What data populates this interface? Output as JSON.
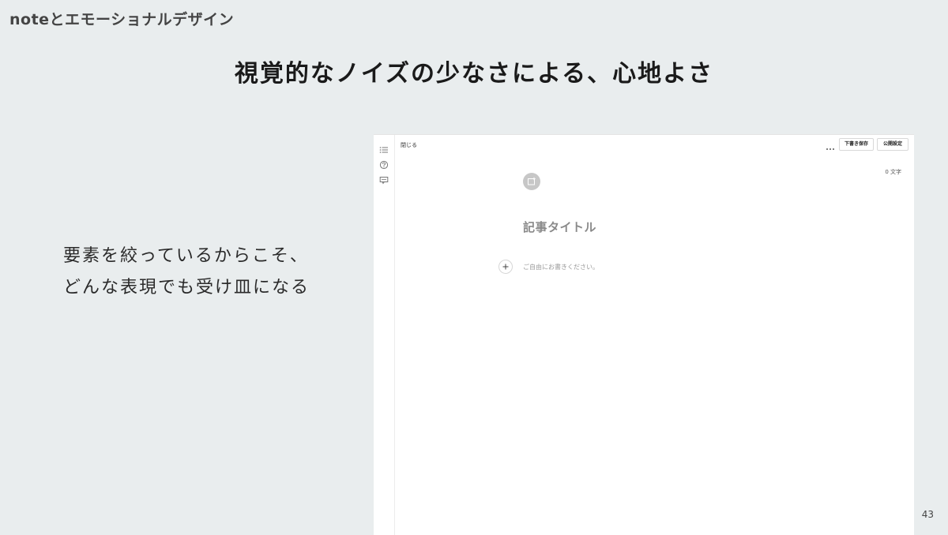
{
  "slide": {
    "header": "noteとエモーショナルデザイン",
    "title": "視覚的なノイズの少なさによる、心地よさ",
    "body_lines": [
      "要素を絞っているからこそ、",
      "どんな表現でも受け皿になる"
    ],
    "page_number": "43"
  },
  "editor": {
    "close_label": "閉じる",
    "more_icon": "ellipsis-icon",
    "draft_button_label": "下書き保存",
    "publish_button_label": "公開設定",
    "char_count": "0 文字",
    "title_placeholder": "記事タイトル",
    "body_placeholder": "ご自由にお書きください。",
    "sidebar_icons": [
      "list-icon",
      "help-icon",
      "comment-icon"
    ],
    "image_icon": "image-add-icon",
    "add_icon": "plus-icon"
  }
}
